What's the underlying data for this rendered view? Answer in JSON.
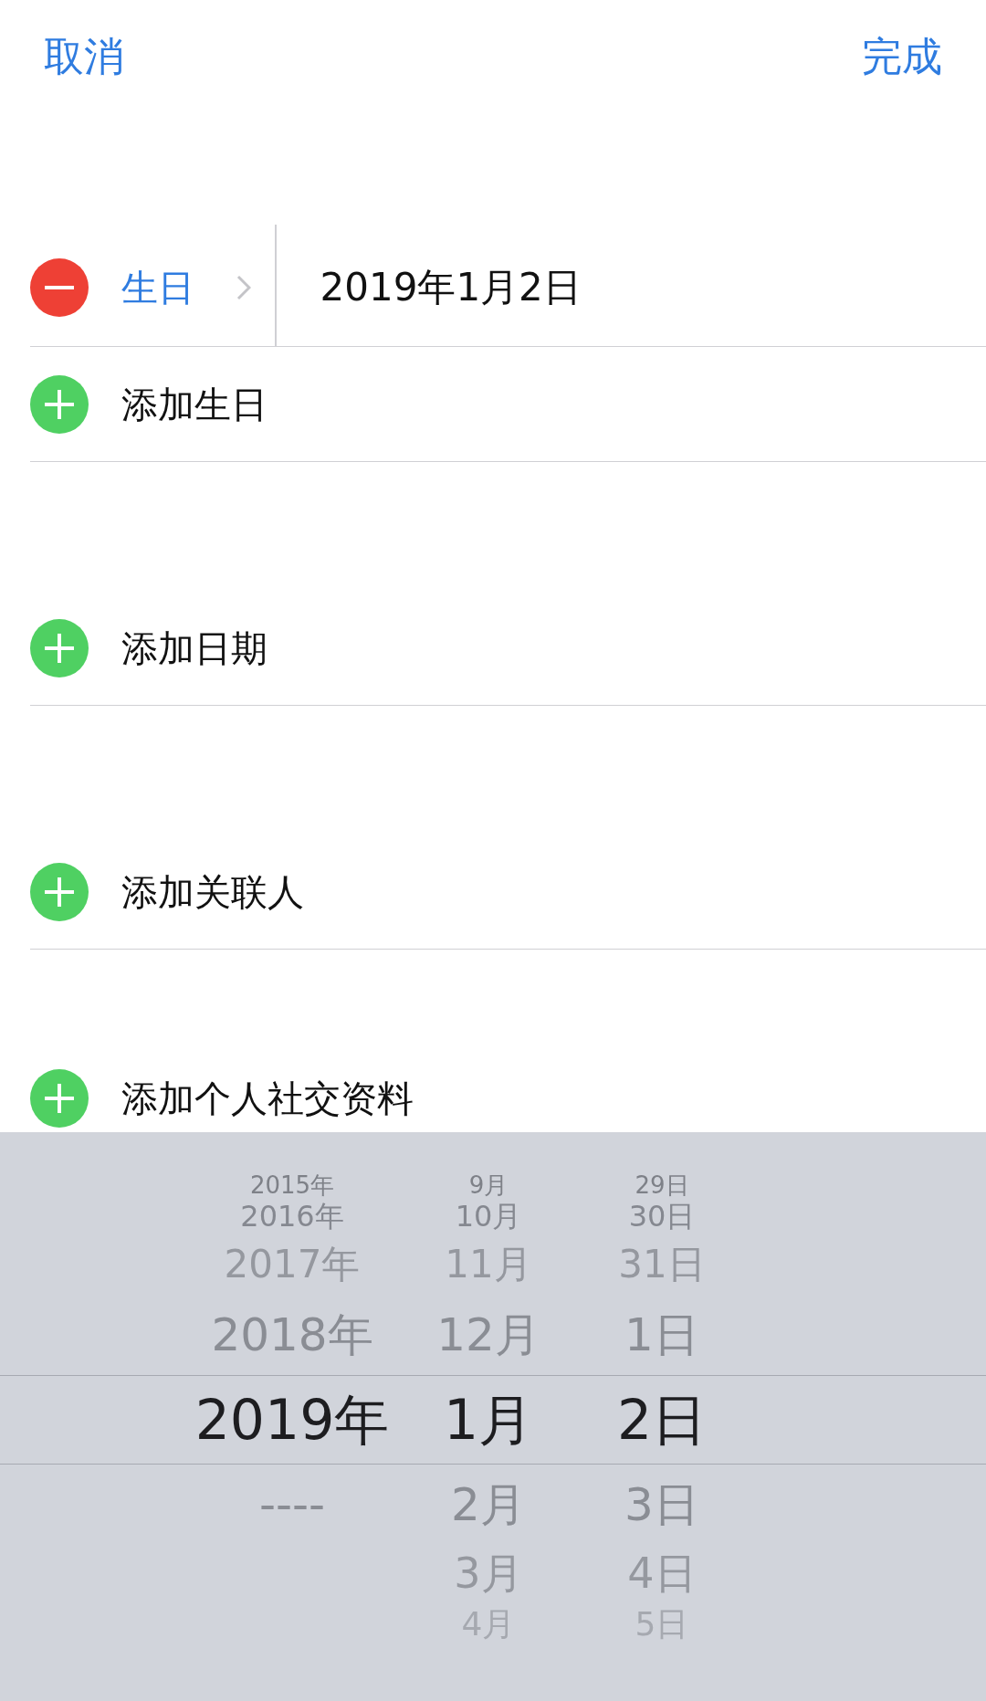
{
  "header": {
    "cancel": "取消",
    "done": "完成"
  },
  "sections": [
    {
      "rows": [
        {
          "kind": "delete",
          "label": "生日",
          "value": "2019年1月2日"
        },
        {
          "kind": "add",
          "label": "添加生日"
        }
      ]
    },
    {
      "rows": [
        {
          "kind": "add",
          "label": "添加日期"
        }
      ]
    },
    {
      "rows": [
        {
          "kind": "add",
          "label": "添加关联人"
        }
      ]
    },
    {
      "rows": [
        {
          "kind": "add",
          "label": "添加个人社交资料"
        }
      ]
    }
  ],
  "picker": {
    "columns": [
      {
        "items": [
          {
            "label": "2015年",
            "selected": false
          },
          {
            "label": "2016年",
            "selected": false
          },
          {
            "label": "2017年",
            "selected": false
          },
          {
            "label": "2018年",
            "selected": false
          },
          {
            "label": "2019年",
            "selected": true
          },
          {
            "label": "----",
            "selected": false
          }
        ]
      },
      {
        "items": [
          {
            "label": "9月",
            "selected": false
          },
          {
            "label": "10月",
            "selected": false
          },
          {
            "label": "11月",
            "selected": false
          },
          {
            "label": "12月",
            "selected": false
          },
          {
            "label": "1月",
            "selected": true
          },
          {
            "label": "2月",
            "selected": false
          },
          {
            "label": "3月",
            "selected": false
          },
          {
            "label": "4月",
            "selected": false
          }
        ]
      },
      {
        "items": [
          {
            "label": "29日",
            "selected": false
          },
          {
            "label": "30日",
            "selected": false
          },
          {
            "label": "31日",
            "selected": false
          },
          {
            "label": "1日",
            "selected": false
          },
          {
            "label": "2日",
            "selected": true
          },
          {
            "label": "3日",
            "selected": false
          },
          {
            "label": "4日",
            "selected": false
          },
          {
            "label": "5日",
            "selected": false
          }
        ]
      }
    ]
  }
}
